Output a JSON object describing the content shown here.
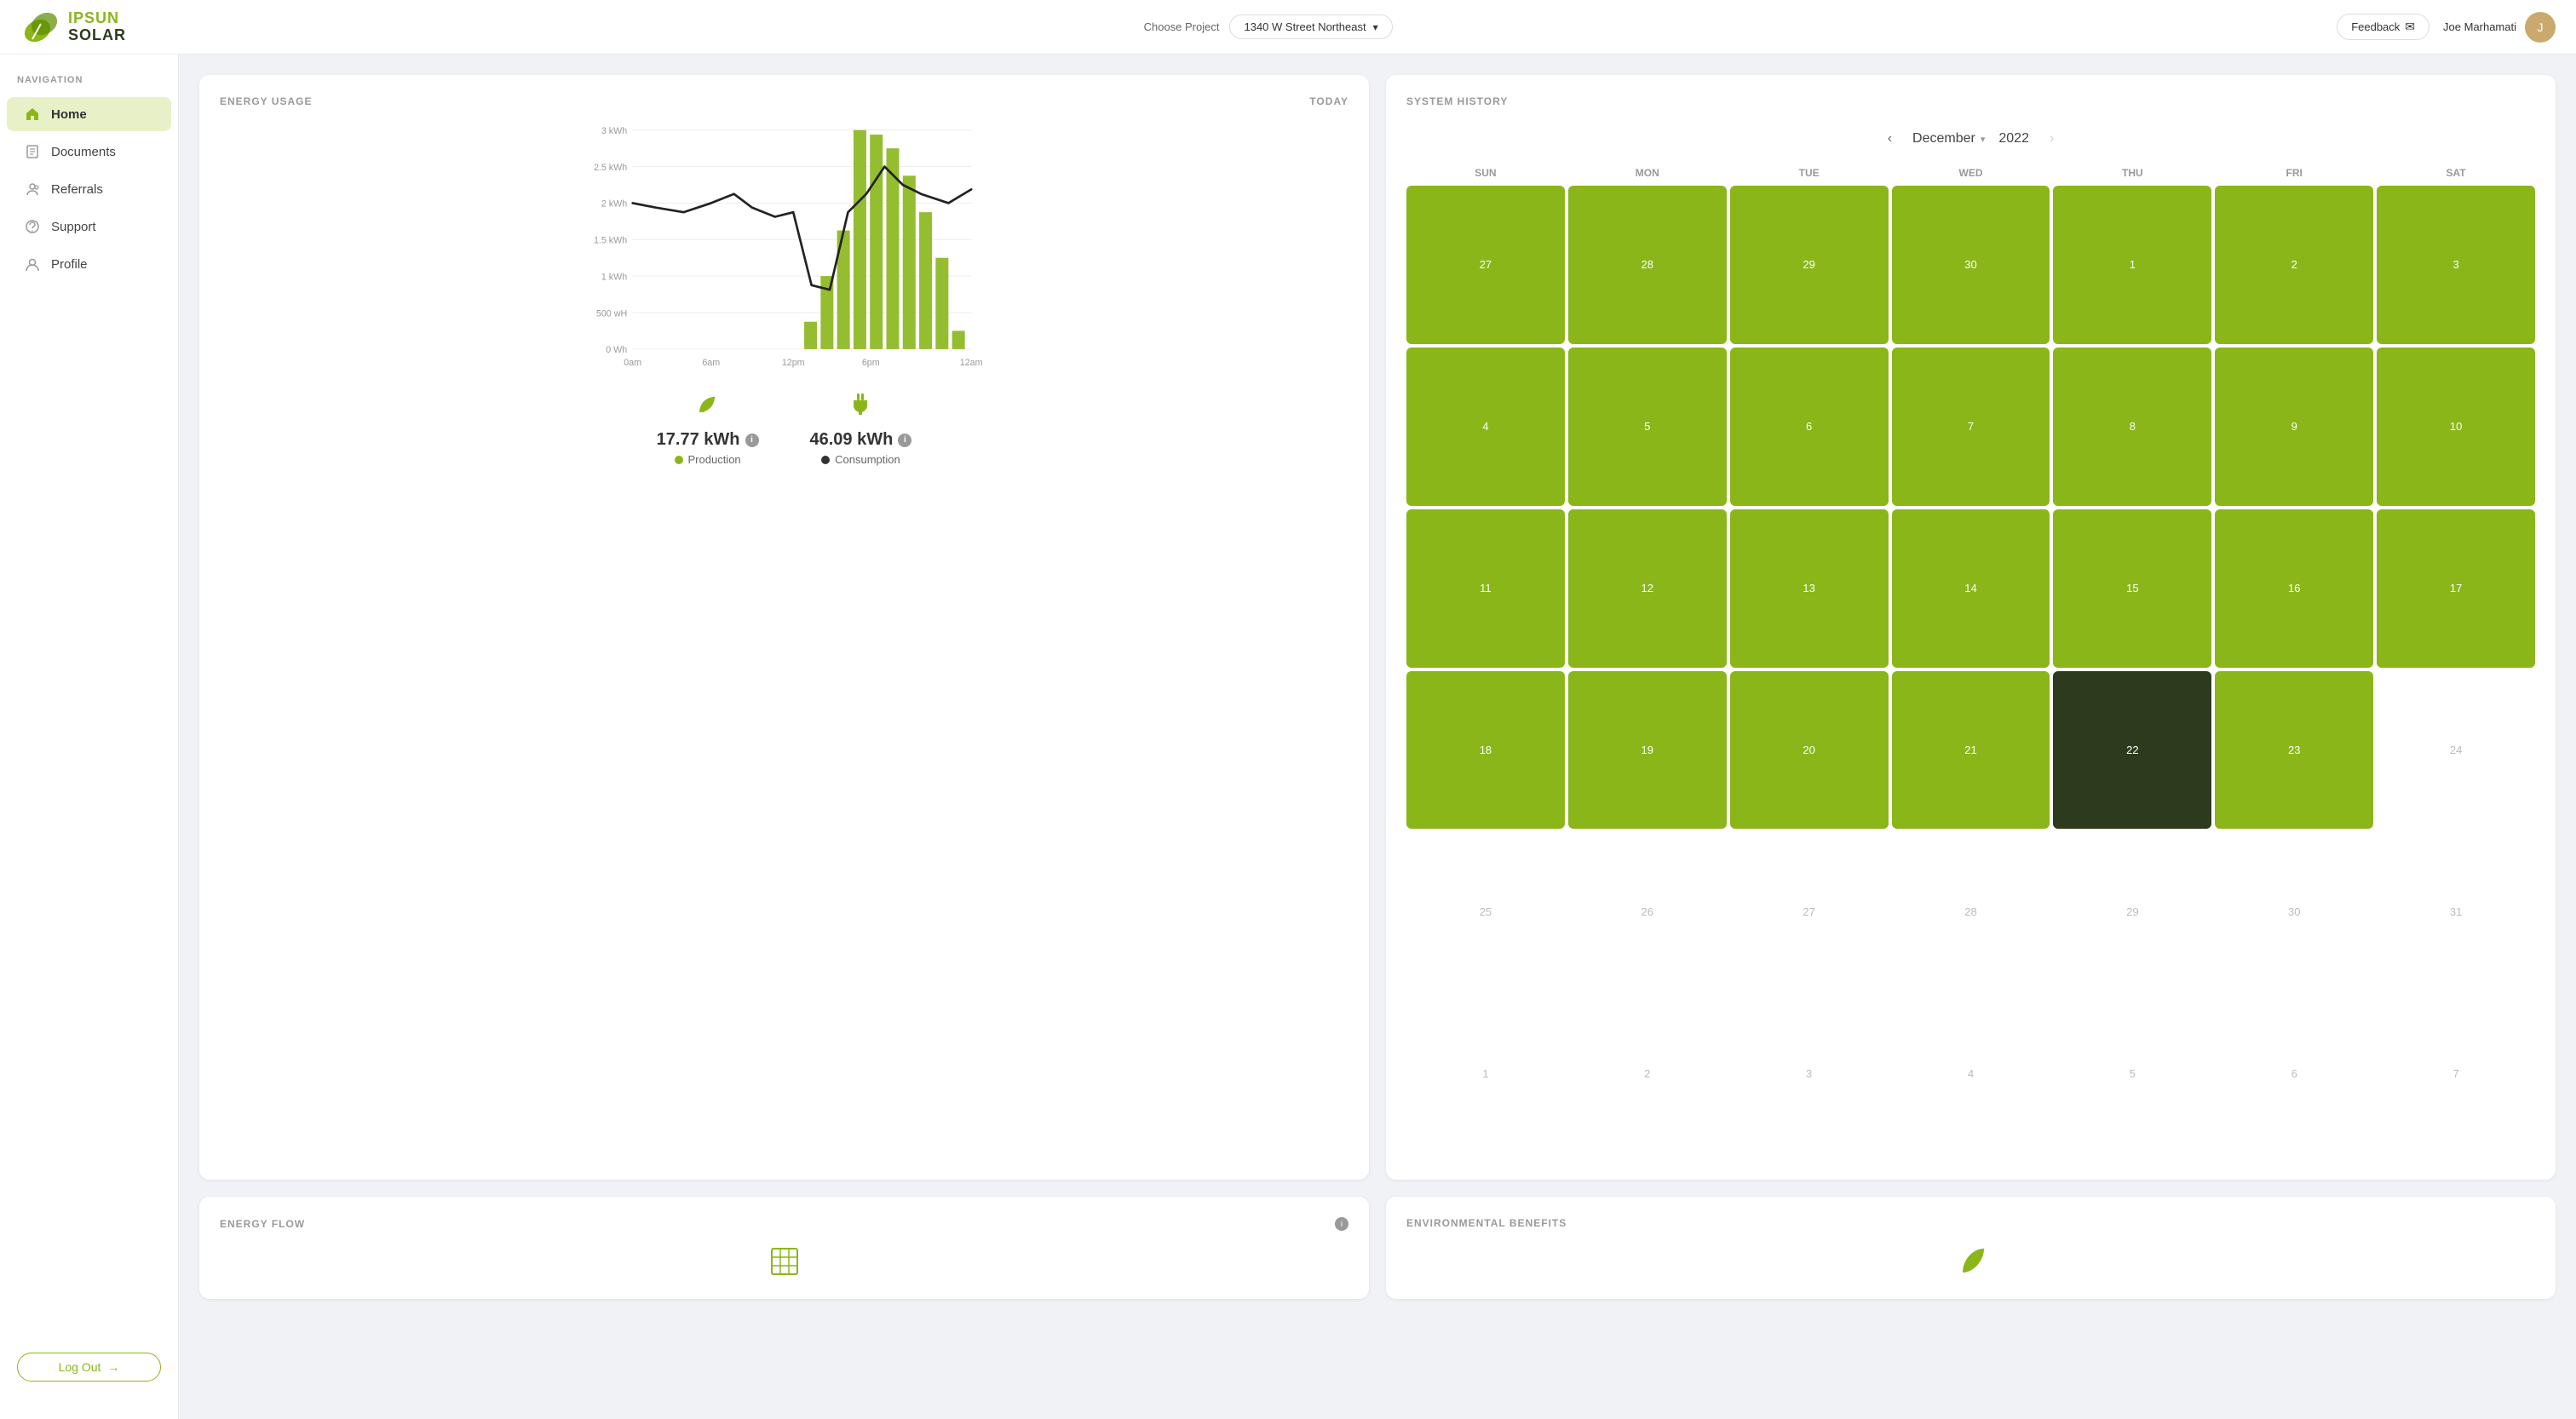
{
  "header": {
    "logo_ipsun": "IPSUN",
    "logo_solar": "SOLAR",
    "choose_project_label": "Choose Project",
    "project_name": "1340 W Street Northeast",
    "feedback_label": "Feedback",
    "user_name": "Joe Marhamati"
  },
  "sidebar": {
    "nav_label": "NAVIGATION",
    "items": [
      {
        "id": "home",
        "label": "Home",
        "active": true
      },
      {
        "id": "documents",
        "label": "Documents",
        "active": false
      },
      {
        "id": "referrals",
        "label": "Referrals",
        "active": false
      },
      {
        "id": "support",
        "label": "Support",
        "active": false
      },
      {
        "id": "profile",
        "label": "Profile",
        "active": false
      }
    ],
    "logout_label": "Log Out"
  },
  "energy_usage": {
    "title": "ENERGY USAGE",
    "date_label": "TODAY",
    "production_value": "17.77 kWh",
    "production_label": "Production",
    "consumption_value": "46.09 kWh",
    "consumption_label": "Consumption",
    "x_labels": [
      "0am",
      "6am",
      "12pm",
      "6pm",
      "12am"
    ],
    "y_labels": [
      "3 kWh",
      "2.5 kWh",
      "2 kWh",
      "1.5 kWh",
      "1 kWh",
      "500 wH",
      "0 Wh"
    ]
  },
  "system_history": {
    "title": "SYSTEM HISTORY",
    "month": "December",
    "year": "2022",
    "day_headers": [
      "SUN",
      "MON",
      "TUE",
      "WED",
      "THU",
      "FRI",
      "SAT"
    ],
    "weeks": [
      [
        {
          "day": 27,
          "type": "green"
        },
        {
          "day": 28,
          "type": "green"
        },
        {
          "day": 29,
          "type": "green"
        },
        {
          "day": 30,
          "type": "green"
        },
        {
          "day": 1,
          "type": "green"
        },
        {
          "day": 2,
          "type": "green"
        },
        {
          "day": 3,
          "type": "green"
        }
      ],
      [
        {
          "day": 4,
          "type": "green"
        },
        {
          "day": 5,
          "type": "green"
        },
        {
          "day": 6,
          "type": "green"
        },
        {
          "day": 7,
          "type": "green"
        },
        {
          "day": 8,
          "type": "green"
        },
        {
          "day": 9,
          "type": "green"
        },
        {
          "day": 10,
          "type": "green"
        }
      ],
      [
        {
          "day": 11,
          "type": "green"
        },
        {
          "day": 12,
          "type": "green"
        },
        {
          "day": 13,
          "type": "green"
        },
        {
          "day": 14,
          "type": "green"
        },
        {
          "day": 15,
          "type": "green"
        },
        {
          "day": 16,
          "type": "green"
        },
        {
          "day": 17,
          "type": "green"
        }
      ],
      [
        {
          "day": 18,
          "type": "green"
        },
        {
          "day": 19,
          "type": "green"
        },
        {
          "day": 20,
          "type": "green"
        },
        {
          "day": 21,
          "type": "green"
        },
        {
          "day": 22,
          "type": "today"
        },
        {
          "day": 23,
          "type": "green"
        },
        {
          "day": 24,
          "type": "faded"
        }
      ],
      [
        {
          "day": 25,
          "type": "faded"
        },
        {
          "day": 26,
          "type": "faded"
        },
        {
          "day": 27,
          "type": "faded"
        },
        {
          "day": 28,
          "type": "faded"
        },
        {
          "day": 29,
          "type": "faded"
        },
        {
          "day": 30,
          "type": "faded"
        },
        {
          "day": 31,
          "type": "faded"
        }
      ],
      [
        {
          "day": 1,
          "type": "faded"
        },
        {
          "day": 2,
          "type": "faded"
        },
        {
          "day": 3,
          "type": "faded"
        },
        {
          "day": 4,
          "type": "faded"
        },
        {
          "day": 5,
          "type": "faded"
        },
        {
          "day": 6,
          "type": "faded"
        },
        {
          "day": 7,
          "type": "faded"
        }
      ]
    ]
  },
  "energy_flow": {
    "title": "ENERGY FLOW"
  },
  "environmental_benefits": {
    "title": "ENVIRONMENTAL BENEFITS"
  }
}
